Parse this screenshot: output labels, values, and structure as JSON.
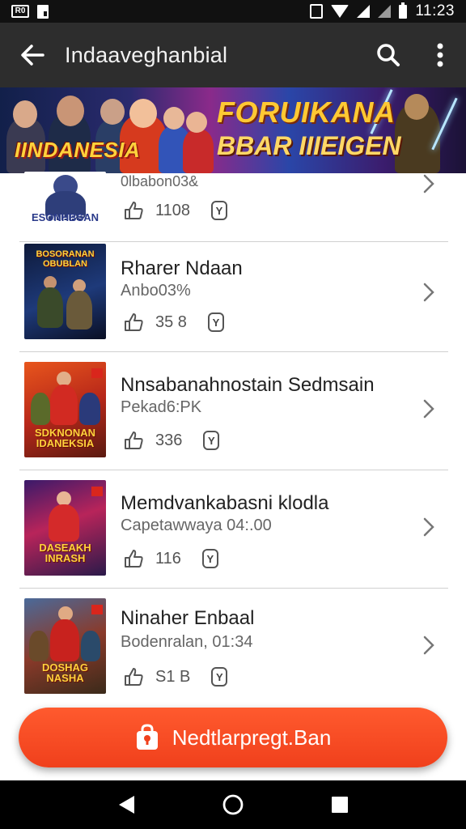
{
  "status_bar": {
    "left_badge": "R0",
    "time": "11:23"
  },
  "app_bar": {
    "title": "Indaaveghanbial"
  },
  "banner": {
    "left_text": "IINDANESIA",
    "right_line1": "FORUIKANA",
    "right_line2": "BBAR IIIEIGEN"
  },
  "list": [
    {
      "thumb_label": "ESONHBSAN",
      "title": "",
      "subtitle": "0lbabon03&",
      "likes": "1108",
      "rating": "Y"
    },
    {
      "thumb_label": "BOSORANAN OBUBLAN",
      "title": "Rharer Ndaan",
      "subtitle": "Anbo03%",
      "likes": "35 8",
      "rating": "Y"
    },
    {
      "thumb_label": "SDKNONAN IDANEKSIA",
      "title": "Nnsabanahnostain Sedmsain",
      "subtitle": "Pekad6:PK",
      "likes": "336",
      "rating": "Y"
    },
    {
      "thumb_label": "DASEAKH INRASH",
      "title": "Memdvankabasni klodla",
      "subtitle": "Capetawwaya 04:.00",
      "likes": "116",
      "rating": "Y"
    },
    {
      "thumb_label": "DOSHAG NASHA",
      "title": "Ninaher Enbaal",
      "subtitle": "Bodenralan, 01:34",
      "likes": "S1 B",
      "rating": "Y"
    }
  ],
  "fab": {
    "label": "Nedtlarpregt.Ban"
  },
  "colors": {
    "accent": "#f0401c",
    "app_bar": "#2d2d2d",
    "status_bar": "#111111"
  },
  "icons": [
    "back-arrow-icon",
    "search-icon",
    "more-vert-icon",
    "chevron-right-icon",
    "like-icon",
    "rating-icon",
    "bag-icon",
    "nav-back-icon",
    "nav-home-icon",
    "nav-recents-icon"
  ]
}
